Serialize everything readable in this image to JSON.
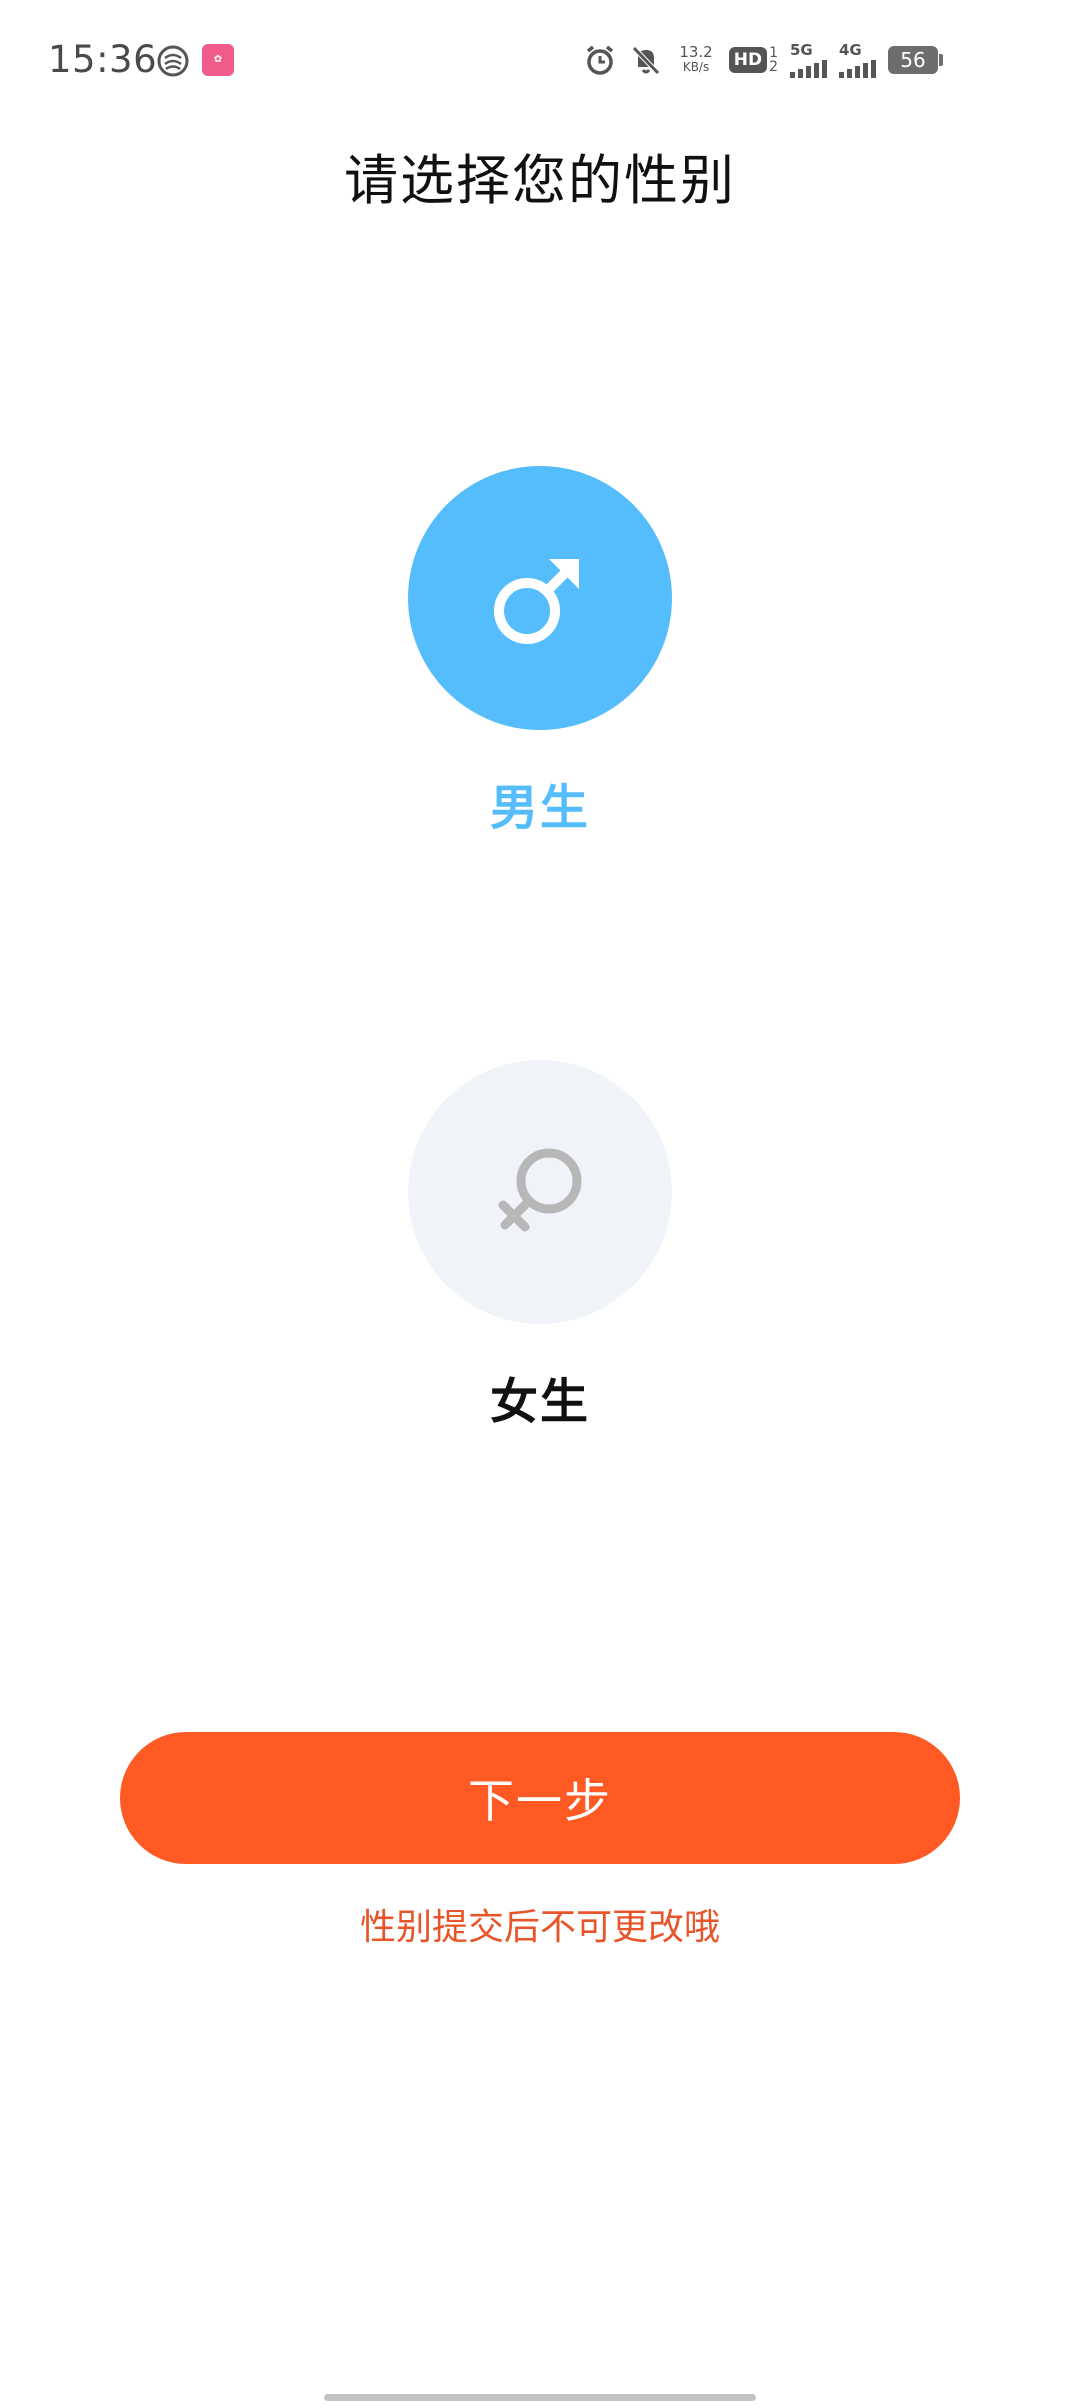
{
  "status_bar": {
    "time": "15:36",
    "net_speed_value": "13.2",
    "net_speed_unit": "KB/s",
    "hd_label": "HD",
    "hd_sub_top": "1",
    "hd_sub_bottom": "2",
    "signal_1_label": "5G",
    "signal_2_label": "4G",
    "battery_level": "56",
    "icons": [
      "carrier-icon",
      "app-notification-icon",
      "alarm-icon",
      "mute-icon",
      "signal-icon",
      "battery-icon"
    ]
  },
  "page": {
    "title": "请选择您的性别"
  },
  "options": {
    "male": {
      "label": "男生",
      "selected": true,
      "icon": "male-symbol-icon",
      "color": "#55bdfb"
    },
    "female": {
      "label": "女生",
      "selected": false,
      "icon": "female-symbol-icon",
      "color": "#f0f3f7"
    }
  },
  "actions": {
    "next_label": "下一步",
    "next_color": "#ff5a24",
    "hint": "性别提交后不可更改哦",
    "hint_color": "#e8552a"
  }
}
